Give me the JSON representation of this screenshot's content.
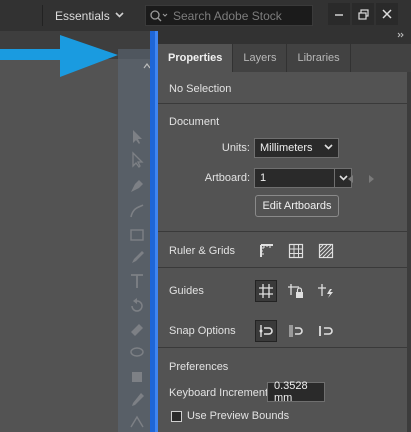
{
  "appbar": {
    "workspace_label": "Essentials",
    "search_placeholder": "Search Adobe Stock"
  },
  "panel": {
    "tabs": [
      {
        "label": "Properties",
        "active": true
      },
      {
        "label": "Layers",
        "active": false
      },
      {
        "label": "Libraries",
        "active": false
      }
    ],
    "selection_status": "No Selection",
    "document": {
      "heading": "Document",
      "units_label": "Units:",
      "units_value": "Millimeters",
      "artboard_label": "Artboard:",
      "artboard_value": "1",
      "edit_artboards_label": "Edit Artboards"
    },
    "ruler_grids_label": "Ruler & Grids",
    "guides_label": "Guides",
    "snap_options_label": "Snap Options",
    "preferences": {
      "heading": "Preferences",
      "keyboard_increment_label": "Keyboard Increment:",
      "keyboard_increment_value": "0.3528 mm",
      "use_preview_bounds_label": "Use Preview Bounds"
    }
  },
  "colors": {
    "accent_blue": "#1e66d6",
    "callout_arrow": "#1a9be0",
    "panel_bg": "#535353",
    "appbar_bg": "#323232"
  }
}
